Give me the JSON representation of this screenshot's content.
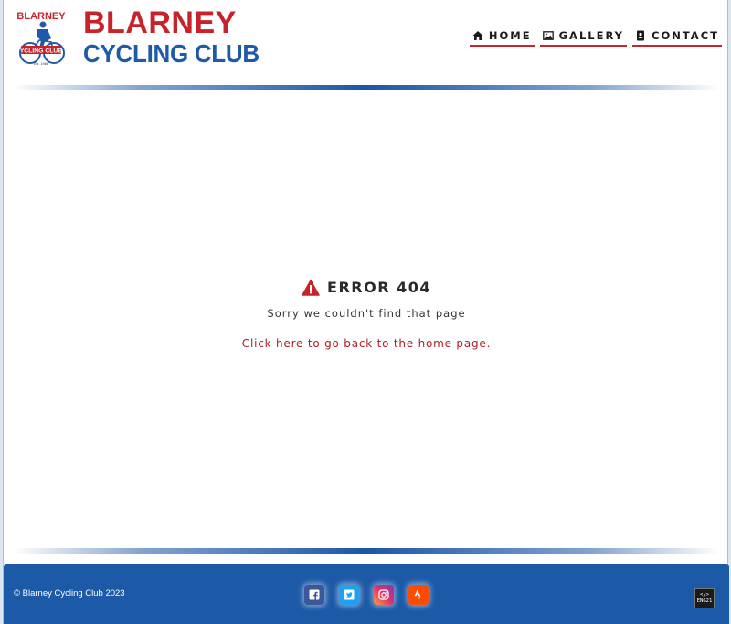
{
  "header": {
    "logo": {
      "top_text": "BLARNEY",
      "ring_text": "YCLING CLUB",
      "est": "Est. 1986"
    },
    "brand_line1": "BLARNEY",
    "brand_line2": "CYCLING CLUB"
  },
  "nav": {
    "items": [
      {
        "label": "HOME",
        "icon": "home-icon"
      },
      {
        "label": "GALLERY",
        "icon": "image-icon"
      },
      {
        "label": "CONTACT",
        "icon": "contact-card-icon"
      }
    ]
  },
  "error": {
    "heading": "ERROR 404",
    "message": "Sorry we couldn't find that page",
    "link_text": "Click here to go back to the home page."
  },
  "footer": {
    "copyright": "© Blarney Cycling Club 2023",
    "socials": [
      "facebook",
      "twitter",
      "instagram",
      "strava"
    ],
    "dev_badge_top": "</>",
    "dev_badge_bottom": "ENG21"
  },
  "colors": {
    "brand_red": "#c8232b",
    "brand_blue": "#1f5aa8",
    "footer_bg": "#1c5aa8"
  }
}
